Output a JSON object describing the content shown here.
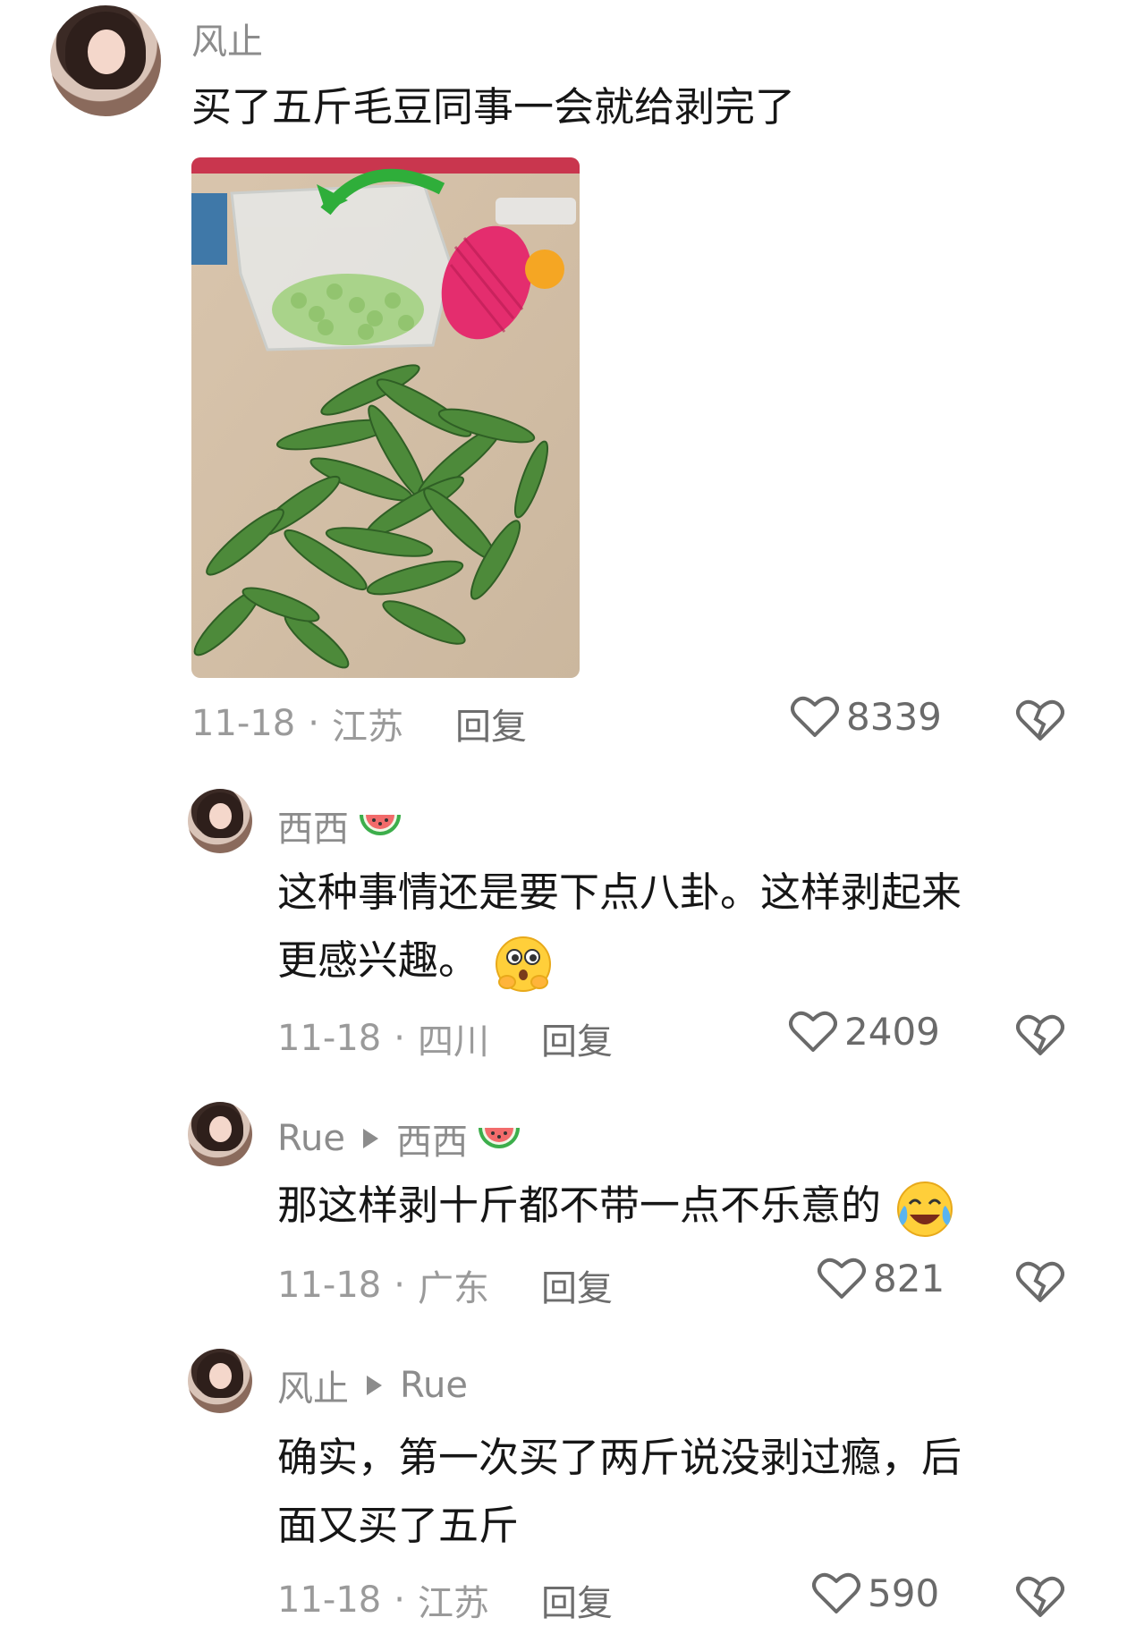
{
  "comments": [
    {
      "user": "风止",
      "text": "买了五斤毛豆同事一会就给剥完了",
      "date": "11-18",
      "location": "江苏",
      "reply_label": "回复",
      "likes": "8339",
      "has_photo": true
    },
    {
      "user": "西西",
      "user_emoji": "watermelon-icon",
      "text_line1": "这种事情还是要下点八卦。这样剥起来",
      "text_line2": "更感兴趣。",
      "text_emoji": "gossip-face-icon",
      "date": "11-18",
      "location": "四川",
      "reply_label": "回复",
      "likes": "2409"
    },
    {
      "user": "Rue",
      "reply_to": "西西",
      "reply_to_emoji": "watermelon-icon",
      "text": "那这样剥十斤都不带一点不乐意的",
      "text_emoji": "crying-laughing-icon",
      "date": "11-18",
      "location": "广东",
      "reply_label": "回复",
      "likes": "821"
    },
    {
      "user": "风止",
      "reply_to": "Rue",
      "text_line1": "确实，第一次买了两斤说没剥过瘾，后",
      "text_line2": "面又买了五斤",
      "date": "11-18",
      "location": "江苏",
      "reply_label": "回复",
      "likes": "590"
    }
  ],
  "separator": "·",
  "colors": {
    "username": "#8c8c8c",
    "meta": "#9a9a9a",
    "text": "#161616"
  }
}
